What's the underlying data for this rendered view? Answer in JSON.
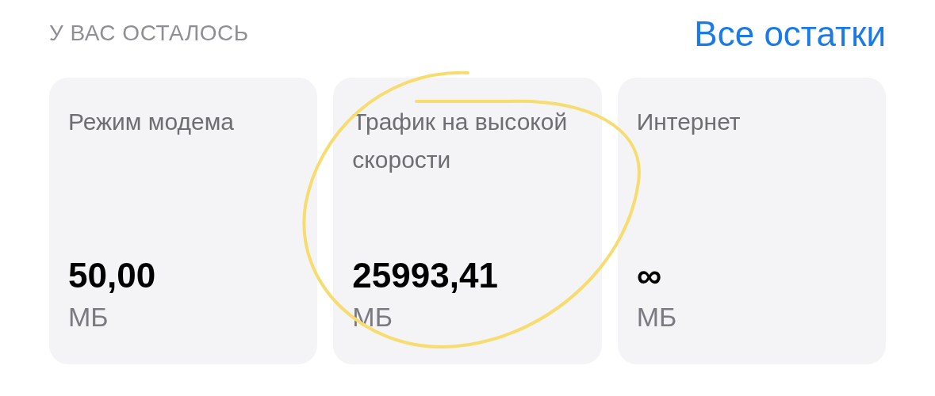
{
  "header": {
    "title": "У ВАС ОСТАЛОСЬ",
    "link": "Все остатки"
  },
  "cards": [
    {
      "title": "Режим модема",
      "value": "50,00",
      "unit": "МБ"
    },
    {
      "title": "Трафик на высокой скорости",
      "value": "25993,41",
      "unit": "МБ"
    },
    {
      "title": "Интернет",
      "value": "∞",
      "unit": "МБ"
    }
  ]
}
